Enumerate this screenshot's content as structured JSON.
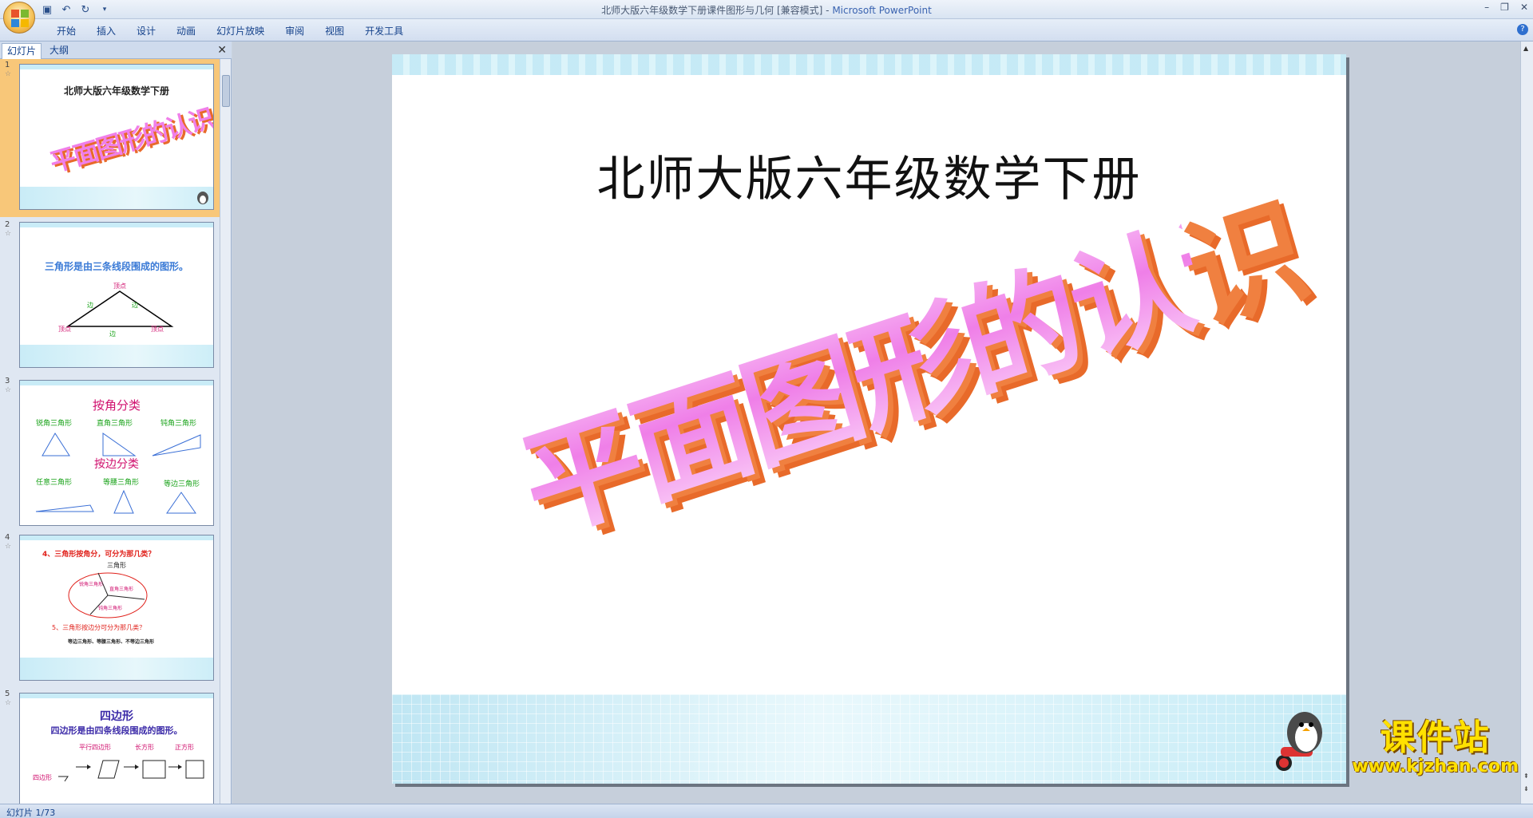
{
  "window": {
    "title": "北师大版六年级数学下册课件图形与几何 [兼容模式] - ",
    "app_name": "Microsoft PowerPoint"
  },
  "ribbon": {
    "tabs": [
      "开始",
      "插入",
      "设计",
      "动画",
      "幻灯片放映",
      "审阅",
      "视图",
      "开发工具"
    ]
  },
  "left_pane": {
    "tab_slides": "幻灯片",
    "tab_outline": "大纲",
    "thumbnails": [
      {
        "num": "1",
        "title": "北师大版六年级数学下册",
        "wordart": "平面图形的认识"
      },
      {
        "num": "2",
        "title": "三角形是由三条线段围成的图形。",
        "vertex": "顶点",
        "side": "边"
      },
      {
        "num": "3",
        "heading1": "按角分类",
        "angle_types": [
          "锐角三角形",
          "直角三角形",
          "钝角三角形"
        ],
        "heading2": "按边分类",
        "side_types": [
          "任意三角形",
          "等腰三角形",
          "等边三角形"
        ]
      },
      {
        "num": "4",
        "q4": "4、三角形按角分，可分为那几类？",
        "center": "三角形",
        "parts": [
          "锐角三角形",
          "直角三角形",
          "钝角三角形"
        ],
        "q5": "5、三角形按边分可分为那几类？",
        "answer5": "等边三角形、等腰三角形、不等边三角形"
      },
      {
        "num": "5",
        "heading": "四边形",
        "subtitle": "四边形是由四条线段围成的图形。",
        "types": [
          "平行四边形",
          "长方形",
          "正方形"
        ],
        "left_label": "四边形"
      }
    ]
  },
  "slide": {
    "subtitle": "北师大版六年级数学下册",
    "wordart": "平面图形的认识"
  },
  "watermark": {
    "text": "课件站",
    "url": "www.kjzhan.com"
  },
  "status": {
    "slide_counter": "幻灯片 1/73"
  },
  "colors": {
    "wordart_face": "#f3a0ef",
    "wordart_side": "#e86a2a",
    "selection": "#f8c779",
    "band": "#c9ecf7"
  }
}
